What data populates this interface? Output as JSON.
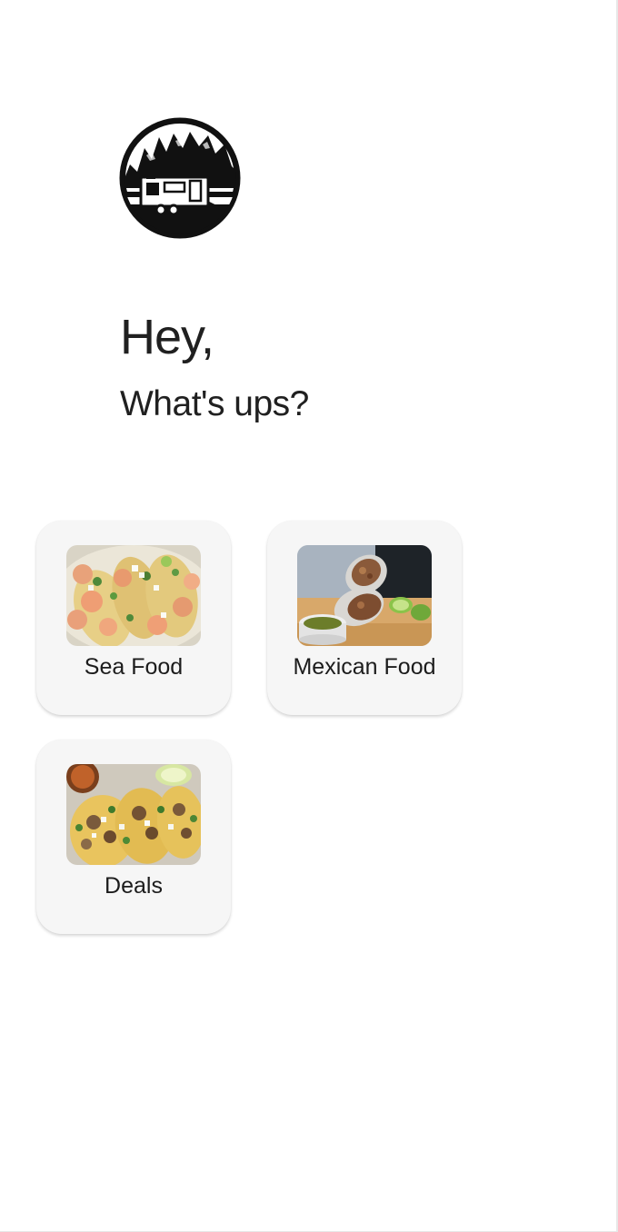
{
  "header": {
    "greeting": "Hey,",
    "subgreeting": "What's ups?"
  },
  "categories": [
    {
      "label": "Sea Food",
      "image": "shrimp-tacos-photo"
    },
    {
      "label": "Mexican Food",
      "image": "burrito-with-salsa-photo"
    },
    {
      "label": "Deals",
      "image": "street-tacos-photo"
    }
  ],
  "colors": {
    "background": "#ffffff",
    "card": "#f6f6f6",
    "text": "#202020"
  }
}
